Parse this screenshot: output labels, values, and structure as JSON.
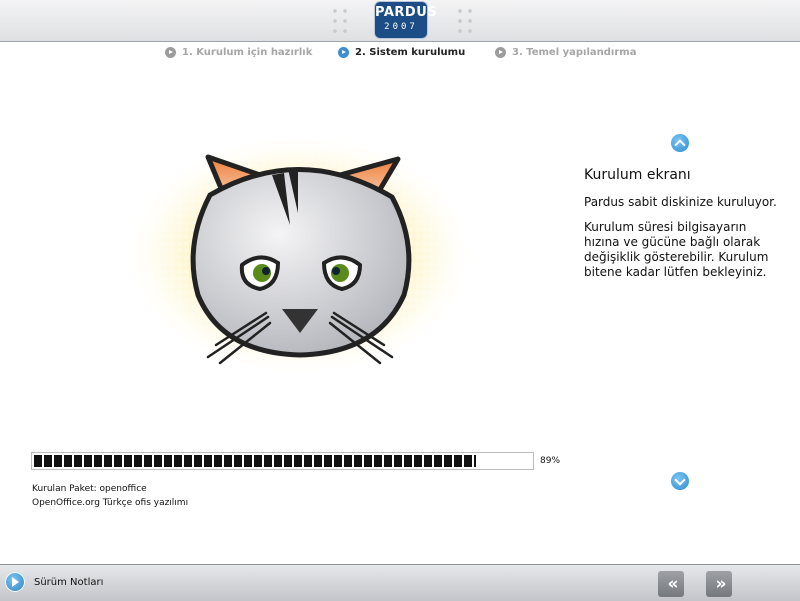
{
  "header": {
    "logo_name": "PARDUS",
    "logo_year": "2007"
  },
  "steps": [
    {
      "label": "1. Kurulum için hazırlık",
      "state": "done"
    },
    {
      "label": "2. Sistem kurulumu",
      "state": "active"
    },
    {
      "label": "3. Temel yapılandırma",
      "state": "pending"
    }
  ],
  "info": {
    "title": "Kurulum ekranı",
    "paragraph1": "Pardus sabit diskinize kuruluyor.",
    "paragraph2": "Kurulum süresi bilgisayarın hızına ve gücüne bağlı olarak değişiklik gösterebilir. Kurulum bitene kadar lütfen bekleyiniz."
  },
  "progress": {
    "value": 89,
    "label": "89%"
  },
  "package": {
    "line1": "Kurulan Paket: openoffice",
    "line2": "OpenOffice.org Türkçe ofis yazılımı"
  },
  "footer": {
    "notes_label": "Sürüm Notları",
    "prev_symbol": "«",
    "next_symbol": "»"
  },
  "colors": {
    "accent": "#3a8fd0",
    "logo_bg": "#1d4d86",
    "cat_ears": "#e8894a",
    "cat_eyes": "#5a8a1c"
  }
}
